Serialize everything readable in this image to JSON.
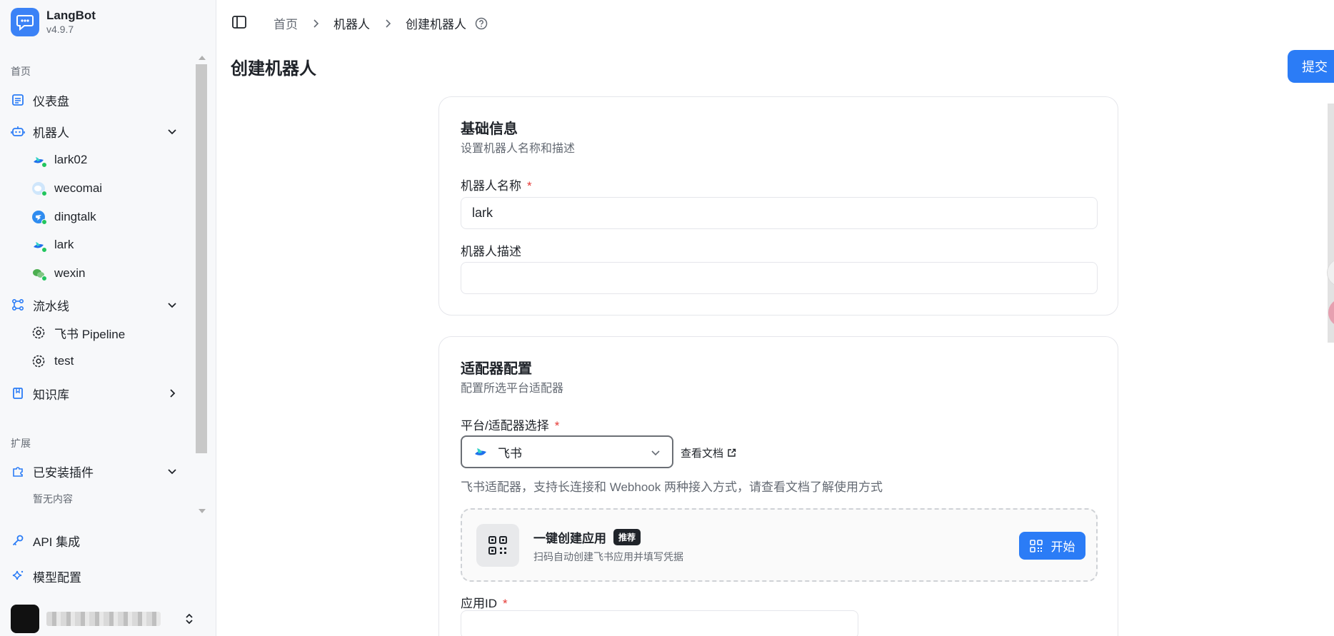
{
  "app": {
    "name": "LangBot",
    "version": "v4.9.7"
  },
  "sidebar": {
    "home_label": "首页",
    "dashboard": "仪表盘",
    "bots": {
      "label": "机器人",
      "items": [
        {
          "label": "lark02",
          "icon": "lark-icon"
        },
        {
          "label": "wecomai",
          "icon": "wecom-icon"
        },
        {
          "label": "dingtalk",
          "icon": "dingtalk-icon"
        },
        {
          "label": "lark",
          "icon": "lark-icon"
        },
        {
          "label": "wexin",
          "icon": "wechat-icon"
        }
      ]
    },
    "pipelines": {
      "label": "流水线",
      "items": [
        {
          "label": "飞书 Pipeline"
        },
        {
          "label": "test"
        }
      ]
    },
    "knowledge": "知识库",
    "extensions_label": "扩展",
    "plugins": {
      "label": "已安装插件",
      "empty": "暂无内容"
    },
    "api": "API 集成",
    "models": "模型配置"
  },
  "header": {
    "breadcrumbs": [
      "首页",
      "机器人",
      "创建机器人"
    ]
  },
  "page": {
    "title": "创建机器人",
    "submit_label": "提交"
  },
  "basic_card": {
    "title": "基础信息",
    "desc": "设置机器人名称和描述",
    "name_label": "机器人名称",
    "name_value": "lark",
    "desc_label": "机器人描述",
    "desc_value": ""
  },
  "adapter_card": {
    "title": "适配器配置",
    "desc": "配置所选平台适配器",
    "platform_label": "平台/适配器选择",
    "platform_value": "飞书",
    "doc_link": "查看文档",
    "note": "飞书适配器，支持长连接和 Webhook 两种接入方式，请查看文档了解使用方式",
    "quick_create": {
      "title": "一键创建应用",
      "badge": "推荐",
      "subtitle": "扫码自动创建飞书应用并填写凭据",
      "button": "开始"
    },
    "app_id_label": "应用ID"
  },
  "colors": {
    "accent": "#2b7cf6",
    "required": "#e53935",
    "online": "#22c55e"
  }
}
